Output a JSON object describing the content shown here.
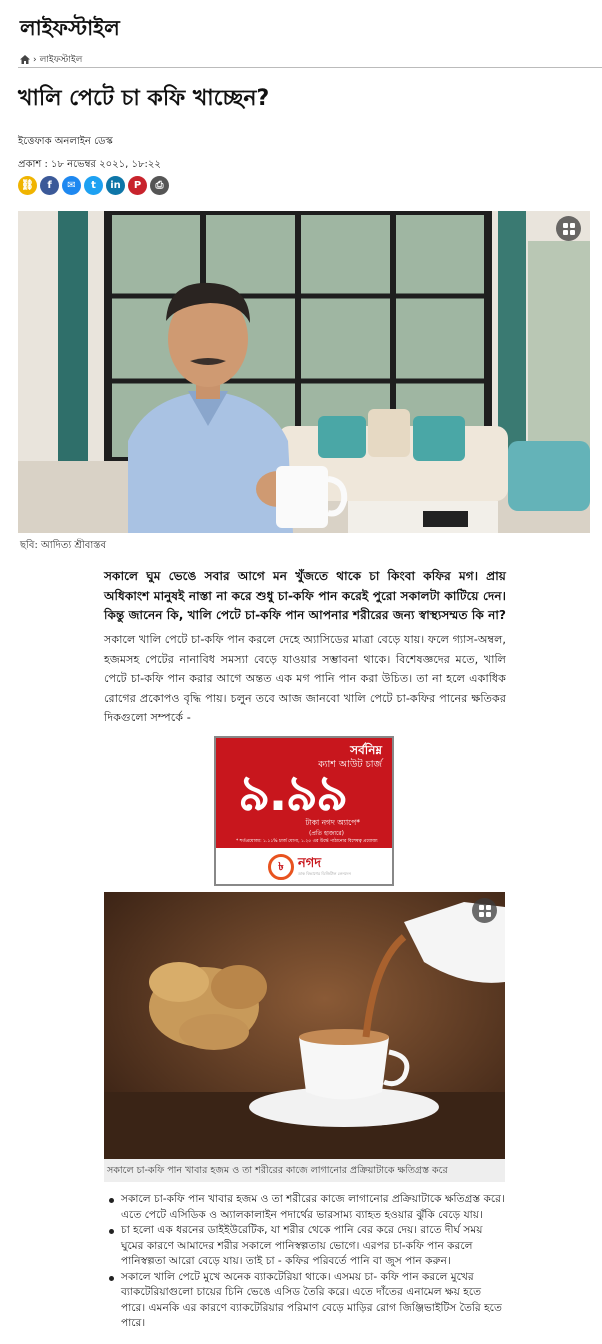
{
  "section": {
    "title": "লাইফস্টাইল"
  },
  "breadcrumb": {
    "separator": "›",
    "current": "লাইফস্টাইল"
  },
  "article": {
    "headline": "খালি পেটে চা কফি খাচ্ছেন?",
    "author": "ইত্তেফাক অনলাইন ডেস্ক",
    "published": "প্রকাশ : ১৮ নভেম্বর ২০২১, ১৮:২২",
    "hero_caption": "ছবি: আদিত্য শ্রীবাস্তব",
    "lead": "সকালে ঘুম ভেঙে সবার আগে মন খুঁজতে থাকে চা কিংবা কফির মগ। প্রায় অধিকাংশ মানুষই নাস্তা না করে শুধু চা-কফি পান করেই পুরো সকালটা কাটিয়ে দেন। কিন্তু জানেন কি, খালি পেটে চা-কফি পান আপনার শরীরের জন্য স্বাস্থ্যসম্মত কি না?",
    "body": "সকালে খালি পেটে চা-কফি পান করলে দেহে অ্যাসিডের মাত্রা বেড়ে যায়। ফলে গ্যাস-অম্বল, হজমসহ পেটের নানাবিধ সমস্যা বেড়ে যাওয়ার সম্ভাবনা থাকে। বিশেষজ্ঞদের মতে, খালি পেটে চা-কফি পান করার আগে অন্তত এক মগ পানি পান করা উচিত। তা না হলে একাধিক রোগের প্রকোপও বৃদ্ধি পায়। চলুন তবে আজ জানবো খালি পেটে চা-কফির পানের ক্ষতিকর দিকগুলো সম্পর্কে -",
    "image2_caption": "সকালে চা-কফি পান খাবার হজম ও তা শরীরের কাজে লাগানোর প্রক্রিয়াটাকে ক্ষতিগ্রস্ত করে",
    "bullets": [
      "সকালে চা-কফি পান খাবার হজম ও তা শরীরের কাজে লাগানোর প্রক্রিয়াটাকে ক্ষতিগ্রস্ত করে। এতে পেটে এসিডিক ও অ্যালকালাইন পদার্থের ভারসাম্য ব্যাহত হওয়ার ঝুঁকি বেড়ে যায়।",
      "চা হলো এক ধরনের ডাইইউরেটিক, যা শরীর থেকে পানি বের করে দেয়। রাতে দীর্ঘ সময় ঘুমের কারণে আমাদের শরীর সকালে পানিস্বল্পতায় ভোগে। এরপর চা-কফি পান করলে পানিস্বল্পতা আরো বেড়ে যায়। তাই চা - কফির পরিবর্তে পানি বা জুস পান করুন।",
      "সকালে খালি পেটে মুখে অনেক ব্যাকটেরিয়া থাকে। এসময় চা- কফি পান করলে মুখের ব্যাকটেরিয়াগুলো চায়ের চিনি ভেঙে এসিড তৈরি করে। এতে দাঁতের এনামেল ক্ষয় হতে পারে। এমনকি এর কারণে ব্যাকটেরিয়ার পরিমাণ বেড়ে মাড়ির রোগ জিঞ্জিভাইটিস তৈরি হতে পারে।"
    ]
  },
  "share": [
    {
      "name": "copy-link-icon",
      "glyph": "⛓",
      "color": "#f0b400"
    },
    {
      "name": "facebook-icon",
      "glyph": "f",
      "color": "#3b5998"
    },
    {
      "name": "messenger-icon",
      "glyph": "✉",
      "color": "#1e88f0"
    },
    {
      "name": "twitter-icon",
      "glyph": "t",
      "color": "#1da1f2"
    },
    {
      "name": "linkedin-icon",
      "glyph": "in",
      "color": "#0e76a8"
    },
    {
      "name": "pinterest-icon",
      "glyph": "P",
      "color": "#c8232c"
    },
    {
      "name": "print-icon",
      "glyph": "⎙",
      "color": "#555555"
    }
  ],
  "ad": {
    "line1": "সর্বনিম্ন",
    "line2": "ক্যাশ আউট চার্জ",
    "amount": "৯.৯৯",
    "line3": "টাকা নগদ অ্যাপে*",
    "line4": "(প্রতি হাজারে)",
    "fineprint": "* শর্তপ্রযোজ্য: ১.১১% চার্জ যোগ্য, ১.২৫ এর উর্দ্ধে পাঠানোর বিশেষত্ব প্রযোজ্য",
    "brand": "নগদ",
    "brand_logo_text": "৳",
    "tagline": "ডাক বিভাগের ডিজিটাল লেনদেন"
  }
}
